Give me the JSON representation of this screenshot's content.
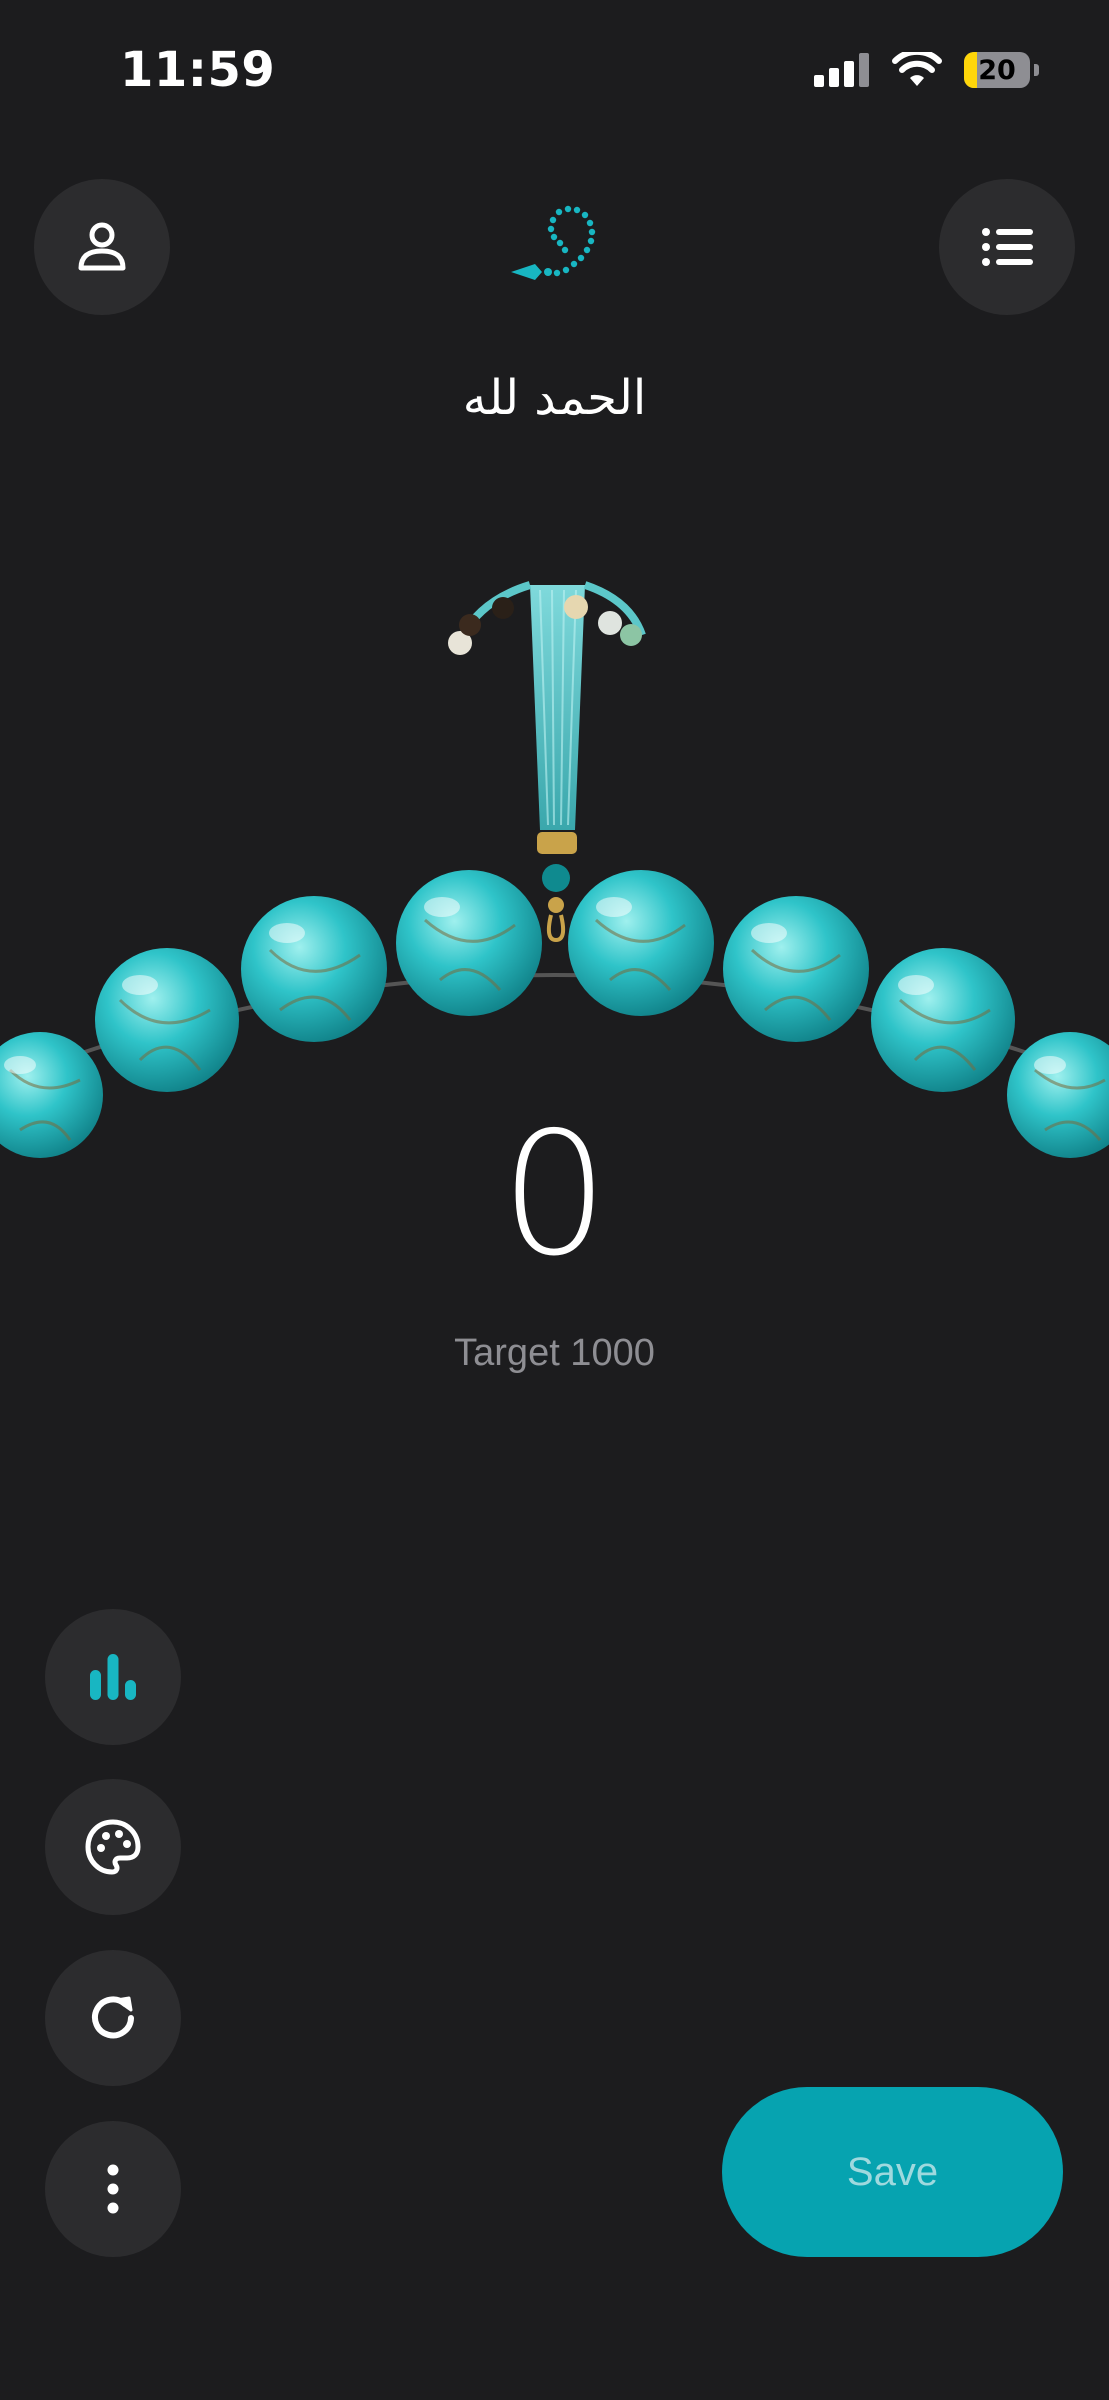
{
  "status_bar": {
    "time": "11:59",
    "battery": "20",
    "battery_level": 0.2
  },
  "header": {
    "profile_icon": "person-icon",
    "logo_icon": "prayer-beads-logo-icon",
    "menu_icon": "list-icon"
  },
  "dhikr": {
    "text": "الحمد لله"
  },
  "counter": {
    "value": "0",
    "target": "Target 1000"
  },
  "side_actions": [
    {
      "icon": "bar-chart-icon"
    },
    {
      "icon": "palette-icon"
    },
    {
      "icon": "refresh-icon"
    },
    {
      "icon": "more-vertical-icon"
    }
  ],
  "save": {
    "label": "Save"
  },
  "colors": {
    "accent": "#06a3b0",
    "background": "#1c1c1e",
    "button": "#2c2c2e",
    "bead": "#2fc4c9"
  }
}
